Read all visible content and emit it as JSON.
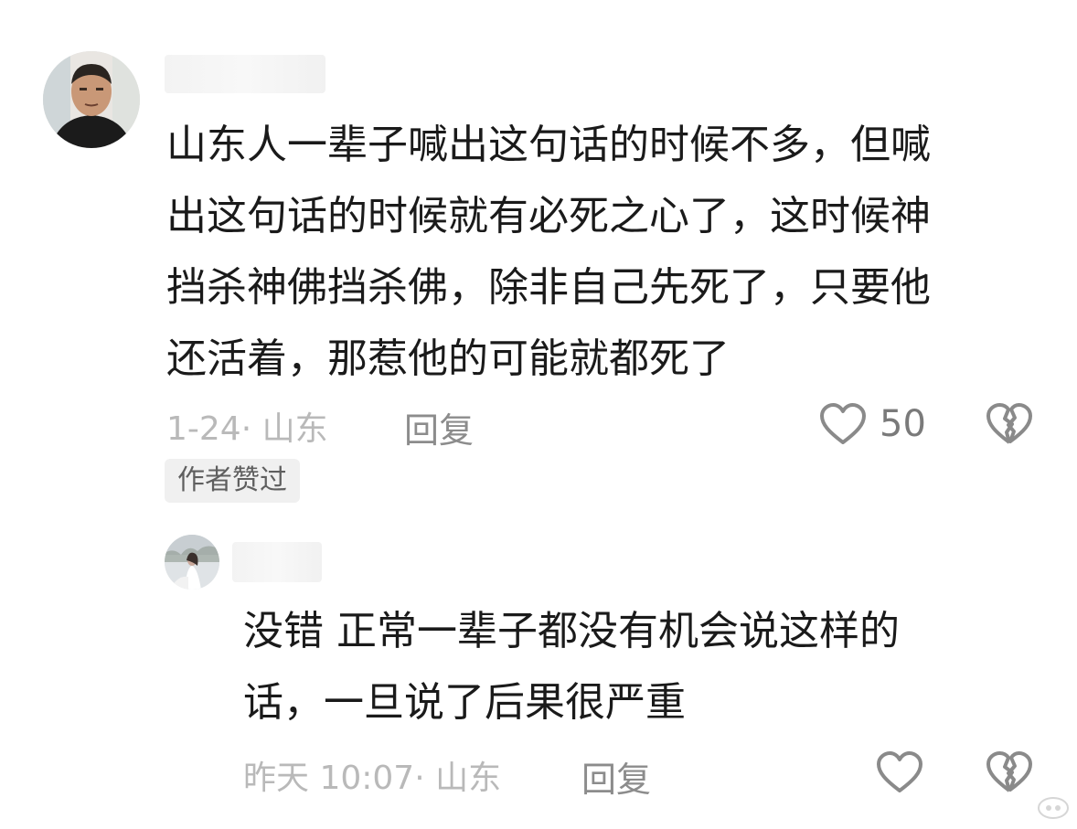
{
  "comments": [
    {
      "text_lines": [
        "山东人一辈子喊出这句话的时候不多，但喊",
        "出这句话的时候就有必死之心了，这时候神",
        "挡杀神佛挡杀佛，除非自己先死了，只要他",
        "还活着，那惹他的可能就都死了"
      ],
      "meta": "1-24· 山东",
      "reply_label": "回复",
      "likes": "50",
      "badge": "作者赞过"
    },
    {
      "text_lines": [
        "没错 正常一辈子都没有机会说这样的",
        "话，一旦说了后果很严重"
      ],
      "meta": "昨天 10:07· 山东",
      "reply_label": "回复"
    }
  ],
  "colors": {
    "text": "#1a1a1a",
    "meta": "#b9b9b9",
    "reply": "#8c8c8c",
    "icon": "#8a8a8a",
    "badge_bg": "#f0f0f0"
  },
  "icons": [
    "heart-outline-icon",
    "broken-heart-icon",
    "watermark-icon"
  ]
}
